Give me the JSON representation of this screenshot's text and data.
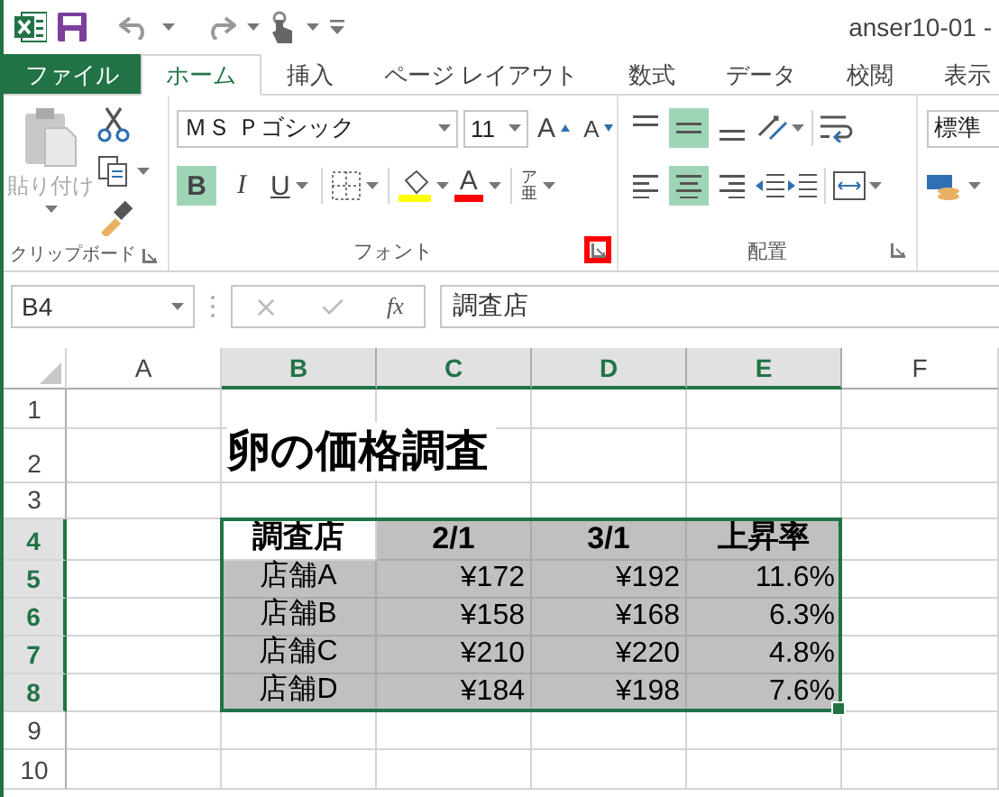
{
  "window": {
    "title": "anser10-01 -"
  },
  "tabs": [
    {
      "label": "ファイル",
      "kind": "file",
      "selected": false
    },
    {
      "label": "ホーム",
      "kind": "tab",
      "selected": true
    },
    {
      "label": "挿入",
      "kind": "tab",
      "selected": false
    },
    {
      "label": "ページ レイアウト",
      "kind": "tab",
      "selected": false
    },
    {
      "label": "数式",
      "kind": "tab",
      "selected": false
    },
    {
      "label": "データ",
      "kind": "tab",
      "selected": false
    },
    {
      "label": "校閲",
      "kind": "tab",
      "selected": false
    },
    {
      "label": "表示",
      "kind": "tab",
      "selected": false
    }
  ],
  "clipboard": {
    "paste_label": "貼り付け",
    "paste_disabled": true,
    "group_label": "クリップボード"
  },
  "font": {
    "name": "ＭＳ Ｐゴシック",
    "size": "11",
    "grow_label": "A",
    "shrink_label": "A",
    "styles": [
      {
        "kind": "bold",
        "label": "B",
        "selected": true
      },
      {
        "kind": "italic",
        "label": "I",
        "selected": false
      },
      {
        "kind": "underline",
        "label": "U",
        "selected": false
      }
    ],
    "font_color_label": "A",
    "phonetic": [
      "ア",
      "亜"
    ],
    "group_label": "フォント",
    "launcher_highlighted": true
  },
  "alignment": {
    "vertical": [
      {
        "selected": false
      },
      {
        "selected": true
      },
      {
        "selected": false
      }
    ],
    "horizontal": [
      {
        "selected": false
      },
      {
        "selected": true
      },
      {
        "selected": false
      }
    ],
    "group_label": "配置"
  },
  "number": {
    "format": "標準"
  },
  "formula_bar": {
    "name_box": "B4",
    "function_label": "fx",
    "formula": "調査店"
  },
  "sheet": {
    "columns": [
      {
        "label": "A",
        "selected": false
      },
      {
        "label": "B",
        "selected": true
      },
      {
        "label": "C",
        "selected": true
      },
      {
        "label": "D",
        "selected": true
      },
      {
        "label": "E",
        "selected": true
      },
      {
        "label": "F",
        "selected": false
      }
    ],
    "rows": [
      {
        "label": "1",
        "selected": false
      },
      {
        "label": "2",
        "selected": false
      },
      {
        "label": "3",
        "selected": false
      },
      {
        "label": "4",
        "selected": true
      },
      {
        "label": "5",
        "selected": true
      },
      {
        "label": "6",
        "selected": true
      },
      {
        "label": "7",
        "selected": true
      },
      {
        "label": "8",
        "selected": true
      },
      {
        "label": "9",
        "selected": false
      },
      {
        "label": "10",
        "selected": false
      }
    ],
    "title": "卵の価格調査",
    "table": {
      "header": [
        "調査店",
        "2/1",
        "3/1",
        "上昇率"
      ],
      "rows": [
        [
          "店舗A",
          "¥172",
          "¥192",
          "11.6%"
        ],
        [
          "店舗B",
          "¥158",
          "¥168",
          "6.3%"
        ],
        [
          "店舗C",
          "¥210",
          "¥220",
          "4.8%"
        ],
        [
          "店舗D",
          "¥184",
          "¥198",
          "7.6%"
        ]
      ]
    }
  }
}
